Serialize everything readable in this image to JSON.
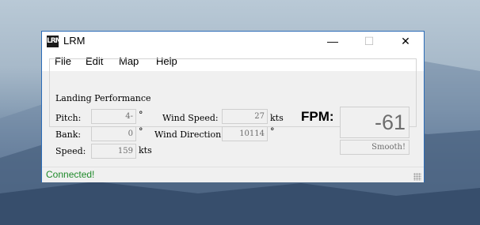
{
  "window": {
    "title": "LRM",
    "icon_text": "LRM",
    "min_glyph": "—",
    "max_glyph": "☐",
    "close_glyph": "✕"
  },
  "menu": {
    "items": [
      "File",
      "Edit",
      "Map",
      "Help"
    ]
  },
  "landing": {
    "group_label": "Landing Performance",
    "pitch_label": "Pitch:",
    "pitch_value": "4-",
    "pitch_unit": "°",
    "bank_label": "Bank:",
    "bank_value": "0",
    "bank_unit": "°",
    "speed_label": "Speed:",
    "speed_value": "159",
    "speed_unit": "kts",
    "wind_speed_label": "Wind Speed:",
    "wind_speed_value": "27",
    "wind_speed_unit": "kts",
    "wind_dir_label": "Wind Direction",
    "wind_dir_value": "10114",
    "wind_dir_unit": "°",
    "fpm_label": "FPM:",
    "fpm_value": "-61",
    "rating": "Smooth!"
  },
  "status": {
    "text": "Connected!"
  },
  "colors": {
    "status_green": "#1f8a2a",
    "window_border": "#2b6cb8"
  }
}
